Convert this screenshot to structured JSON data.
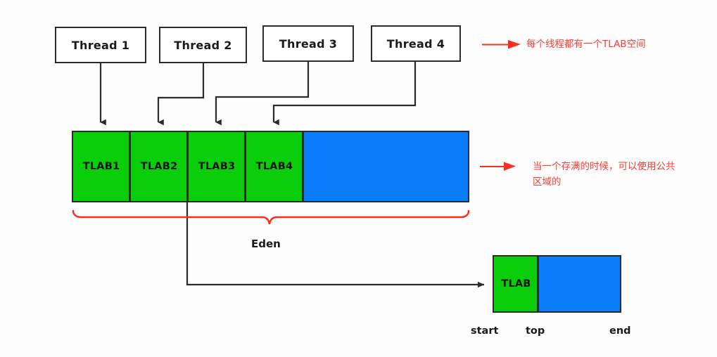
{
  "diagram": {
    "title_concept": "JVM TLAB allocation in Eden space",
    "threads": [
      {
        "label": "Thread 1"
      },
      {
        "label": "Thread 2"
      },
      {
        "label": "Thread 3"
      },
      {
        "label": "Thread 4"
      }
    ],
    "eden": {
      "region_label": "Eden",
      "tlab_cells": [
        {
          "label": "TLAB1",
          "color": "#0ACE0A"
        },
        {
          "label": "TLAB2",
          "color": "#0ACE0A"
        },
        {
          "label": "TLAB3",
          "color": "#0ACE0A"
        },
        {
          "label": "TLAB4",
          "color": "#0ACE0A"
        }
      ],
      "shared_area": {
        "label": "",
        "color": "#0a7efa"
      }
    },
    "annotations": [
      {
        "text": "每个线程都有一个TLAB空间",
        "color": "#ff3b2f"
      },
      {
        "text": "当一个存满的时候，可以使用公共\n区域的",
        "color": "#ff3b2f"
      }
    ],
    "detail_box": {
      "tlab_label": "TLAB",
      "used_color": "#0ACE0A",
      "free_color": "#0a7efa",
      "markers": [
        {
          "label": "start"
        },
        {
          "label": "top"
        },
        {
          "label": "end"
        }
      ]
    },
    "colors": {
      "green": "#0ACE0A",
      "blue": "#0a7efa",
      "stroke": "#2b2b2b",
      "accent_red": "#ff3b2f",
      "background": "#fdfdfd"
    }
  }
}
